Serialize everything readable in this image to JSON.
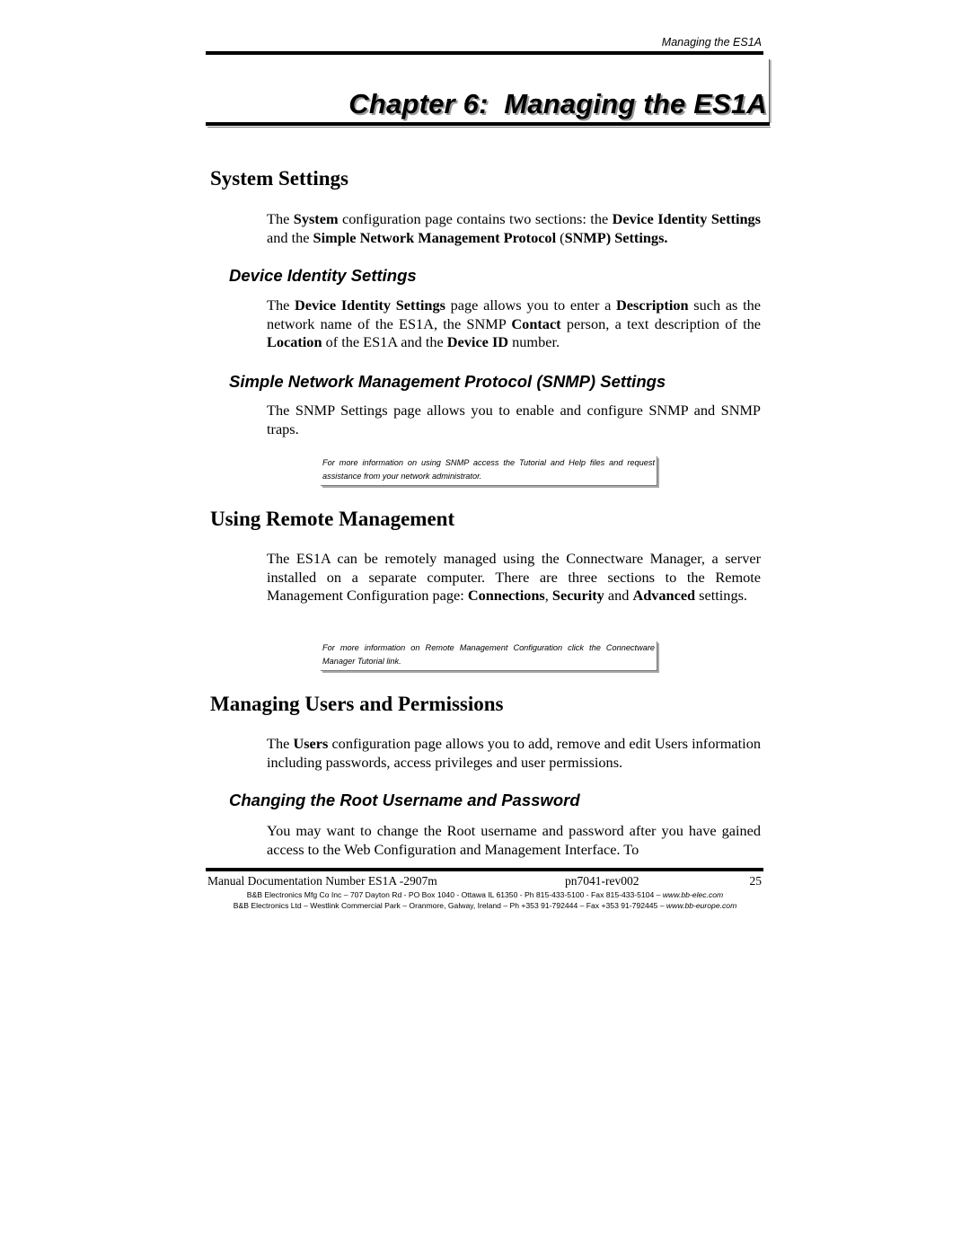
{
  "running_head": "Managing the ES1A",
  "chapter_title": "Chapter 6:  Managing the ES1A",
  "sections": {
    "system_settings": {
      "heading": "System Settings",
      "intro": [
        {
          "t": "The ",
          "b": false
        },
        {
          "t": "System",
          "b": true
        },
        {
          "t": " configuration page contains two sections: the ",
          "b": false
        },
        {
          "t": "Device Identity Settings",
          "b": true
        },
        {
          "t": " and the ",
          "b": false
        },
        {
          "t": "Simple Network Management Protocol",
          "b": true
        },
        {
          "t": " (",
          "b": false
        },
        {
          "t": "SNMP) Settings.",
          "b": true
        }
      ],
      "device_identity": {
        "heading": "Device Identity Settings",
        "body": [
          {
            "t": "The ",
            "b": false
          },
          {
            "t": "Device Identity Settings",
            "b": true
          },
          {
            "t": " page allows you to enter a ",
            "b": false
          },
          {
            "t": "Description",
            "b": true
          },
          {
            "t": " such as the network name of the ES1A, the SNMP ",
            "b": false
          },
          {
            "t": "Contact",
            "b": true
          },
          {
            "t": " person, a text description of the ",
            "b": false
          },
          {
            "t": "Location",
            "b": true
          },
          {
            "t": " of the ES1A and the ",
            "b": false
          },
          {
            "t": "Device ID",
            "b": true
          },
          {
            "t": " number.",
            "b": false
          }
        ]
      },
      "snmp": {
        "heading": "Simple Network Management Protocol (SNMP) Settings",
        "body": [
          {
            "t": "The SNMP Settings page allows you to enable and configure SNMP and SNMP traps.",
            "b": false
          }
        ],
        "note": "For more information on using SNMP access the Tutorial and Help files and request assistance from your network administrator."
      }
    },
    "remote_management": {
      "heading": "Using Remote Management",
      "body": [
        {
          "t": "The ES1A can be remotely managed using the Connectware Manager, a server installed on a separate computer. There are three sections to the Remote Management Configuration page: ",
          "b": false
        },
        {
          "t": "Connections",
          "b": true
        },
        {
          "t": ", ",
          "b": false
        },
        {
          "t": "Security",
          "b": true
        },
        {
          "t": " and ",
          "b": false
        },
        {
          "t": "Advanced",
          "b": true
        },
        {
          "t": " settings.",
          "b": false
        }
      ],
      "note": "For more information on Remote Management Configuration click the Connectware Manager Tutorial link."
    },
    "users": {
      "heading": "Managing Users and Permissions",
      "body": [
        {
          "t": "The ",
          "b": false
        },
        {
          "t": "Users",
          "b": true
        },
        {
          "t": " configuration page allows you to add, remove and edit Users information including passwords, access privileges and user permissions.",
          "b": false
        }
      ],
      "root": {
        "heading": "Changing the Root Username and Password",
        "body": [
          {
            "t": "You may want to change the Root username and password after you have gained access to the Web Configuration and Management Interface. To",
            "b": false
          }
        ]
      }
    }
  },
  "footer": {
    "doc_number": "Manual Documentation Number ES1A -2907m",
    "part_number": "pn7041-rev002",
    "page_number": "25",
    "address_us": "B&B Electronics Mfg Co Inc – 707 Dayton Rd - PO Box 1040 - Ottawa IL 61350 - Ph 815-433-5100 - Fax 815-433-5104 – ",
    "url_us": "www.bb-elec.com",
    "address_eu": "B&B Electronics Ltd – Westlink Commercial Park – Oranmore, Galway, Ireland – Ph +353 91-792444 – Fax +353 91-792445 – ",
    "url_eu": "www.bb-europe.com"
  }
}
